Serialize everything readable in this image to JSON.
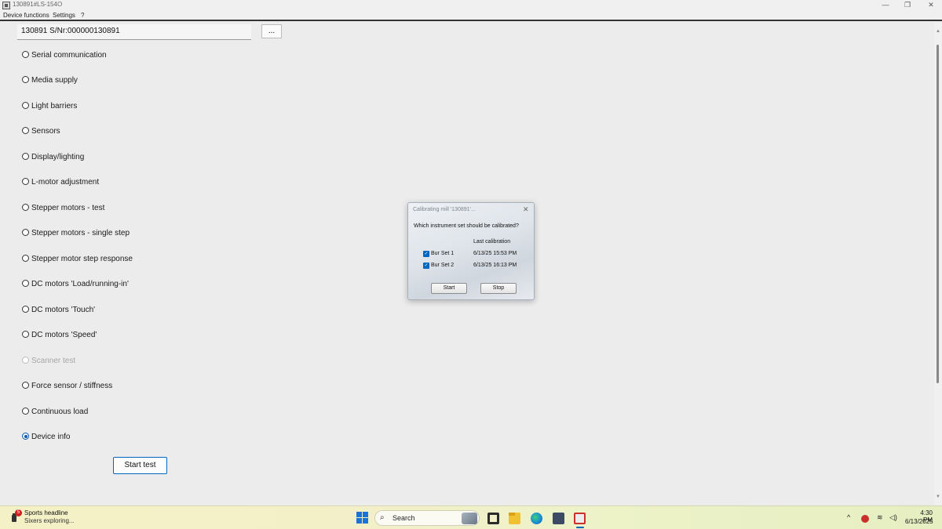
{
  "window": {
    "title": "130891#LS-154O",
    "minimize": "—",
    "maximize": "❐",
    "close": "✕"
  },
  "menu": {
    "items": [
      "Device functions",
      "Settings",
      "?"
    ]
  },
  "device": {
    "field_value": "130891 S/Nr:000000130891",
    "browse_label": "..."
  },
  "tests": [
    {
      "label": "Serial communication",
      "state": "unchecked"
    },
    {
      "label": "Media supply",
      "state": "unchecked"
    },
    {
      "label": "Light barriers",
      "state": "unchecked"
    },
    {
      "label": "Sensors",
      "state": "unchecked"
    },
    {
      "label": "Display/lighting",
      "state": "unchecked"
    },
    {
      "label": "L-motor adjustment",
      "state": "unchecked"
    },
    {
      "label": "Stepper motors - test",
      "state": "unchecked"
    },
    {
      "label": "Stepper motors - single step",
      "state": "unchecked"
    },
    {
      "label": "Stepper motor step response",
      "state": "unchecked"
    },
    {
      "label": "DC motors 'Load/running-in'",
      "state": "unchecked"
    },
    {
      "label": "DC motors 'Touch'",
      "state": "unchecked"
    },
    {
      "label": "DC motors 'Speed'",
      "state": "unchecked"
    },
    {
      "label": "Scanner test",
      "state": "disabled"
    },
    {
      "label": "Force sensor / stiffness",
      "state": "unchecked"
    },
    {
      "label": "Continuous load",
      "state": "unchecked"
    },
    {
      "label": "Device info",
      "state": "checked"
    }
  ],
  "start_test_label": "Start test",
  "dialog": {
    "title": "Calibrating mill '130891'...",
    "close": "✕",
    "question": "Which instrument set should be calibrated?",
    "last_calibration_header": "Last calibration",
    "rows": [
      {
        "label": "Bur Set 1",
        "date": "6/13/25 15:53 PM",
        "checked": true
      },
      {
        "label": "Bur Set 2",
        "date": "6/13/25 16:13 PM",
        "checked": true
      }
    ],
    "start_label": "Start",
    "stop_label": "Stop"
  },
  "taskbar": {
    "news_badge": "5",
    "news_title": "Sports headline",
    "news_subtitle": "Sixers exploring...",
    "search_icon": "⌕",
    "search_placeholder": "Search",
    "tray_chevron": "^",
    "wifi_icon": "≋",
    "volume_icon": "◁)",
    "time": "4:30 PM",
    "date": "6/13/2025"
  },
  "colors": {
    "accent": "#0067c0",
    "taskbar": "#f3f0c9"
  }
}
